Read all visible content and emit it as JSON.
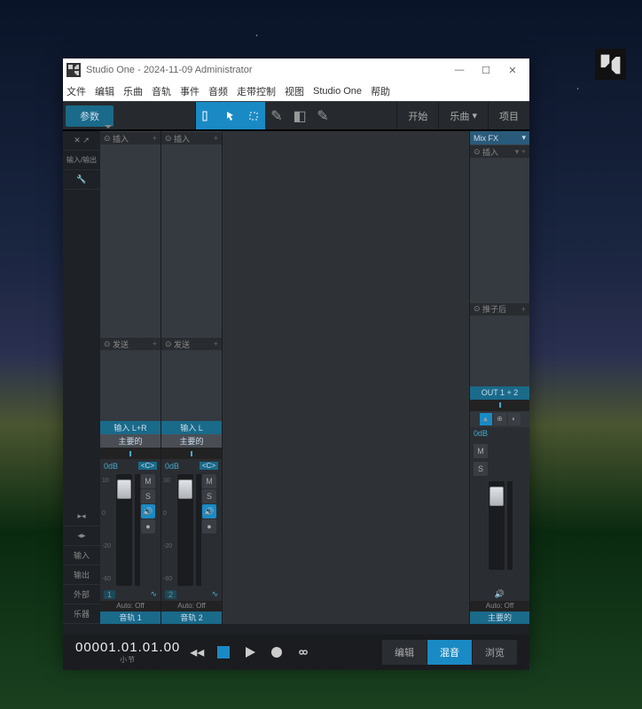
{
  "window": {
    "title": "Studio One - 2024-11-09 Administrator"
  },
  "menu": {
    "file": "文件",
    "edit": "编辑",
    "song": "乐曲",
    "track": "音轨",
    "event": "事件",
    "audio": "音频",
    "transport": "走带控制",
    "view": "视图",
    "studio_one": "Studio One",
    "help": "帮助"
  },
  "toolbar": {
    "param": "参数",
    "start": "开始",
    "song": "乐曲",
    "project": "项目"
  },
  "channel": {
    "inserts": "插入",
    "sends": "发送",
    "in1": "输入 L+R",
    "in2": "输入 L",
    "main": "主要的",
    "db": "0dB",
    "mc": "<C>",
    "auto": "Auto: Off",
    "name1": "音轨 1",
    "name2": "音轨 2"
  },
  "left_panel": {
    "io": "输入/输出",
    "in": "输入",
    "out": "输出",
    "ext": "外部",
    "inst": "乐器"
  },
  "right_panel": {
    "mixfx": "Mix FX",
    "inserts": "插入",
    "postfader": "推子后",
    "out": "OUT 1 + 2",
    "db": "0dB",
    "auto": "Auto: Off",
    "main": "主要的"
  },
  "transport_bar": {
    "time": "00001.01.01.00",
    "unit": "小节",
    "edit": "编辑",
    "mix": "混音",
    "browse": "浏览"
  }
}
